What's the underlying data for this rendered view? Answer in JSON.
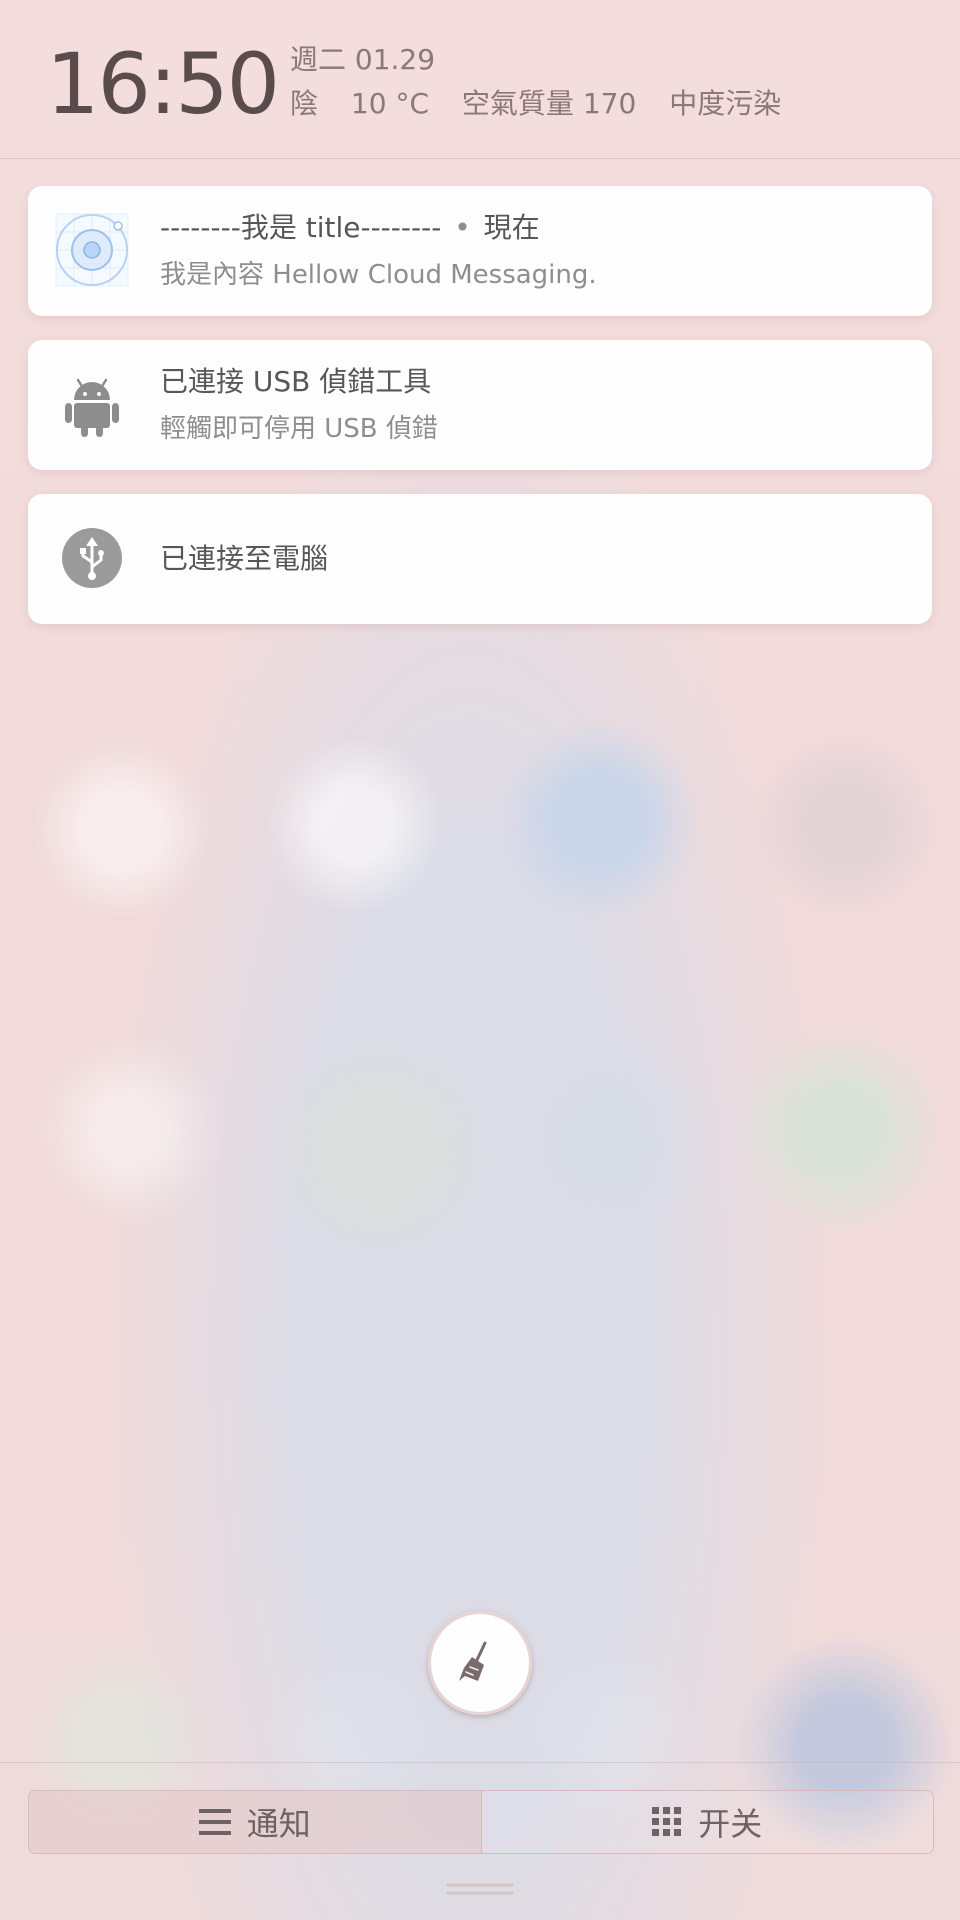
{
  "header": {
    "time": "16:50",
    "date": "週二  01.29",
    "weather_condition": "陰",
    "temperature": "10 °C",
    "air_quality": "空氣質量 170",
    "pollution": "中度污染"
  },
  "notifications": [
    {
      "icon": "app-icon",
      "title": "--------我是 title--------",
      "separator": "•",
      "time": "現在",
      "subtitle": "我是內容 Hellow Cloud Messaging."
    },
    {
      "icon": "android-icon",
      "title": "已連接 USB 偵錯工具",
      "subtitle": "輕觸即可停用 USB 偵錯"
    },
    {
      "icon": "usb-icon",
      "title": "已連接至電腦"
    }
  ],
  "actions": {
    "clear_icon": "broom-icon"
  },
  "tabs": [
    {
      "label": "通知",
      "icon": "list-icon"
    },
    {
      "label": "开关",
      "icon": "grid-icon"
    }
  ]
}
